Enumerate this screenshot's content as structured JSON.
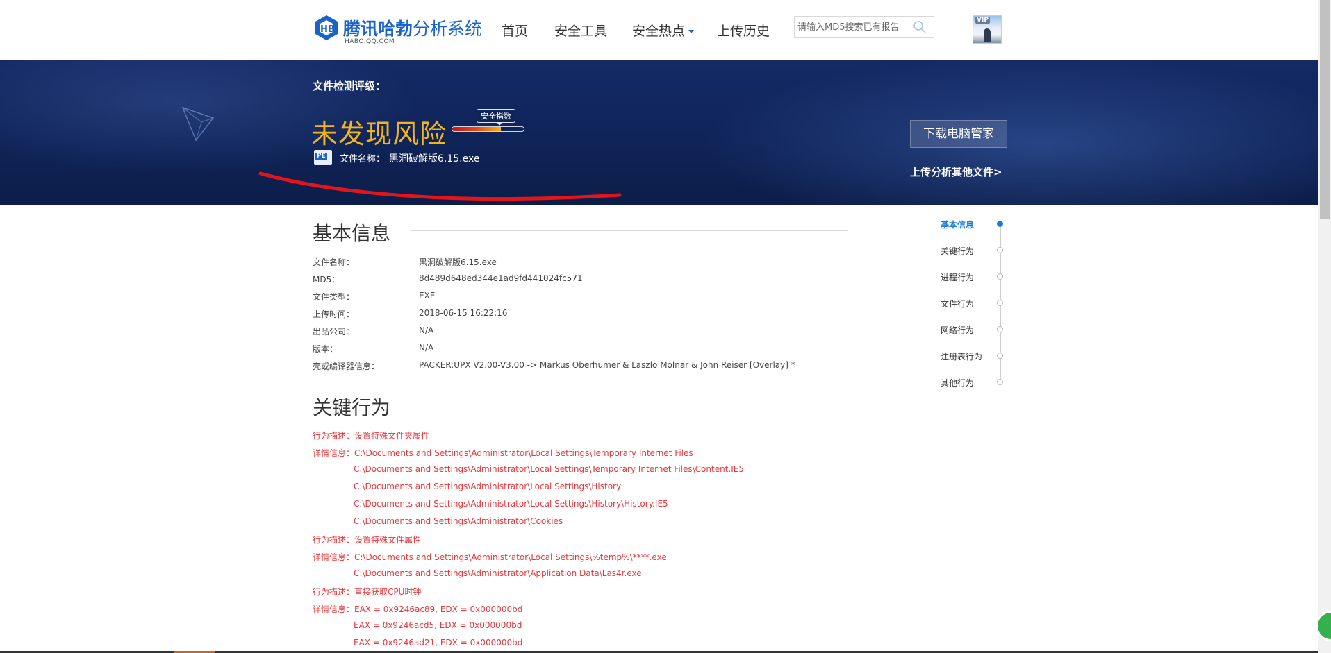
{
  "header": {
    "logo_title_bold": "腾讯哈勃",
    "logo_title_rest": "分析系统",
    "logo_subtitle": "HABO.QQ.COM",
    "nav": [
      "首页",
      "安全工具",
      "安全热点",
      "上传历史"
    ],
    "search_placeholder": "请输入MD5搜索已有报告",
    "avatar_badge": "VIP"
  },
  "banner": {
    "rating_label": "文件检测评级：",
    "risk_result": "未发现风险",
    "gauge_tip": "安全指数",
    "gauge_level_percent": 68,
    "pe_badge": "PE",
    "filename_label": "文件名称：",
    "filename_value": "黑洞破解版6.15.exe",
    "download_button": "下载电脑管家",
    "upload_other": "上传分析其他文件>"
  },
  "basic_info": {
    "title": "基本信息",
    "rows": [
      {
        "k": "文件名称：",
        "v": "黑洞破解版6.15.exe"
      },
      {
        "k": "MD5：",
        "v": "8d489d648ed344e1ad9fd441024fc571"
      },
      {
        "k": "文件类型：",
        "v": "EXE"
      },
      {
        "k": "上传时间：",
        "v": "2018-06-15 16:22:16"
      },
      {
        "k": "出品公司：",
        "v": "N/A"
      },
      {
        "k": "版本：",
        "v": "N/A"
      },
      {
        "k": "壳或编译器信息：",
        "v": "PACKER:UPX V2.00-V3.00 -> Markus Oberhumer & Laszlo Molnar & John Reiser [Overlay] *"
      }
    ]
  },
  "key_behavior": {
    "title": "关键行为",
    "lines": [
      {
        "type": "desc",
        "text": "行为描述：设置特殊文件夹属性"
      },
      {
        "type": "detail",
        "text": "详情信息：C:\\Documents and Settings\\Administrator\\Local Settings\\Temporary Internet Files"
      },
      {
        "type": "cont",
        "text": "C:\\Documents and Settings\\Administrator\\Local Settings\\Temporary Internet Files\\Content.IE5"
      },
      {
        "type": "cont",
        "text": "C:\\Documents and Settings\\Administrator\\Local Settings\\History"
      },
      {
        "type": "cont",
        "text": "C:\\Documents and Settings\\Administrator\\Local Settings\\History\\History.IE5"
      },
      {
        "type": "cont",
        "text": "C:\\Documents and Settings\\Administrator\\Cookies"
      },
      {
        "type": "desc",
        "text": "行为描述：设置特殊文件属性"
      },
      {
        "type": "detail",
        "text": "详情信息：C:\\Documents and Settings\\Administrator\\Local Settings\\%temp%\\****.exe"
      },
      {
        "type": "cont",
        "text": "C:\\Documents and Settings\\Administrator\\Application Data\\Las4r.exe"
      },
      {
        "type": "desc",
        "text": "行为描述：直接获取CPU时钟"
      },
      {
        "type": "detail",
        "text": "详情信息：EAX = 0x9246ac89, EDX = 0x000000bd"
      },
      {
        "type": "cont",
        "text": "EAX = 0x9246acd5, EDX = 0x000000bd"
      },
      {
        "type": "cont",
        "text": "EAX = 0x9246ad21, EDX = 0x000000bd"
      }
    ]
  },
  "side_nav": {
    "items": [
      "基本信息",
      "关键行为",
      "进程行为",
      "文件行为",
      "网络行为",
      "注册表行为",
      "其他行为"
    ],
    "active_index": 0
  },
  "colors": {
    "brand_blue": "#1a63c9",
    "risk_orange": "#f5b41b",
    "behavior_red": "#e8363a",
    "banner_navy": "#0f2458"
  }
}
